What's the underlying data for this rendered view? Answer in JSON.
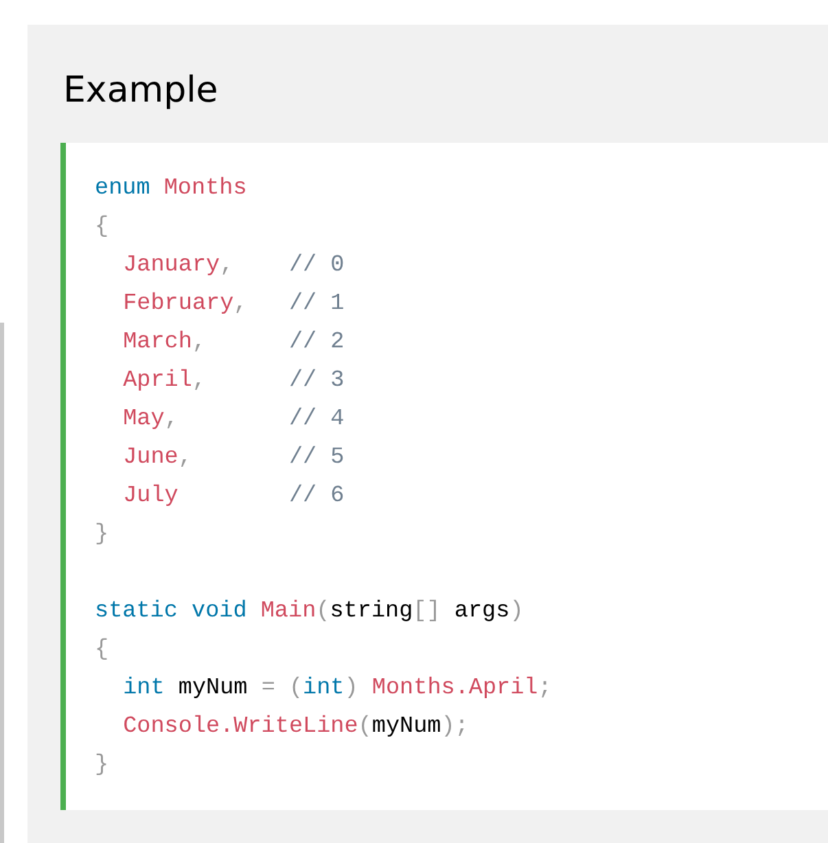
{
  "heading": "Example",
  "code_groups": [
    {
      "lines": [
        {
          "indented": false,
          "tokens": [
            {
              "text": "enum ",
              "kind": "keyword"
            },
            {
              "text": "Months",
              "kind": "name"
            }
          ]
        },
        {
          "indented": false,
          "tokens": [
            {
              "text": "{",
              "kind": "punct"
            }
          ]
        },
        {
          "indented": true,
          "tokens": [
            {
              "text": "January",
              "kind": "name"
            },
            {
              "text": ",",
              "kind": "punct"
            },
            {
              "text": "    // 0",
              "kind": "comment"
            }
          ]
        },
        {
          "indented": true,
          "tokens": [
            {
              "text": "February",
              "kind": "name"
            },
            {
              "text": ",",
              "kind": "punct"
            },
            {
              "text": "   // 1",
              "kind": "comment"
            }
          ]
        },
        {
          "indented": true,
          "tokens": [
            {
              "text": "March",
              "kind": "name"
            },
            {
              "text": ",",
              "kind": "punct"
            },
            {
              "text": "      // 2",
              "kind": "comment"
            }
          ]
        },
        {
          "indented": true,
          "tokens": [
            {
              "text": "April",
              "kind": "name"
            },
            {
              "text": ",",
              "kind": "punct"
            },
            {
              "text": "      // 3",
              "kind": "comment"
            }
          ]
        },
        {
          "indented": true,
          "tokens": [
            {
              "text": "May",
              "kind": "name"
            },
            {
              "text": ",",
              "kind": "punct"
            },
            {
              "text": "        // 4",
              "kind": "comment"
            }
          ]
        },
        {
          "indented": true,
          "tokens": [
            {
              "text": "June",
              "kind": "name"
            },
            {
              "text": ",",
              "kind": "punct"
            },
            {
              "text": "       // 5",
              "kind": "comment"
            }
          ]
        },
        {
          "indented": true,
          "tokens": [
            {
              "text": "July",
              "kind": "name"
            },
            {
              "text": "        // 6",
              "kind": "comment"
            }
          ]
        },
        {
          "indented": false,
          "tokens": [
            {
              "text": "}",
              "kind": "punct"
            }
          ]
        }
      ]
    },
    {
      "lines": [
        {
          "indented": false,
          "tokens": [
            {
              "text": "static void ",
              "kind": "keyword"
            },
            {
              "text": "Main",
              "kind": "name"
            },
            {
              "text": "(",
              "kind": "punct"
            },
            {
              "text": "string",
              "kind": "plain"
            },
            {
              "text": "[]",
              "kind": "punct"
            },
            {
              "text": " args",
              "kind": "plain"
            },
            {
              "text": ")",
              "kind": "punct"
            }
          ]
        },
        {
          "indented": false,
          "tokens": [
            {
              "text": "{",
              "kind": "punct"
            }
          ]
        },
        {
          "indented": true,
          "tokens": [
            {
              "text": "int",
              "kind": "keyword"
            },
            {
              "text": " myNum ",
              "kind": "plain"
            },
            {
              "text": "= (",
              "kind": "punct"
            },
            {
              "text": "int",
              "kind": "keyword"
            },
            {
              "text": ") ",
              "kind": "punct"
            },
            {
              "text": "Months.April",
              "kind": "name"
            },
            {
              "text": ";",
              "kind": "punct"
            }
          ]
        },
        {
          "indented": true,
          "tokens": [
            {
              "text": "Console.WriteLine",
              "kind": "name"
            },
            {
              "text": "(",
              "kind": "punct"
            },
            {
              "text": "myNum",
              "kind": "plain"
            },
            {
              "text": ");",
              "kind": "punct"
            }
          ]
        },
        {
          "indented": false,
          "tokens": [
            {
              "text": "}",
              "kind": "punct"
            }
          ]
        }
      ]
    }
  ]
}
